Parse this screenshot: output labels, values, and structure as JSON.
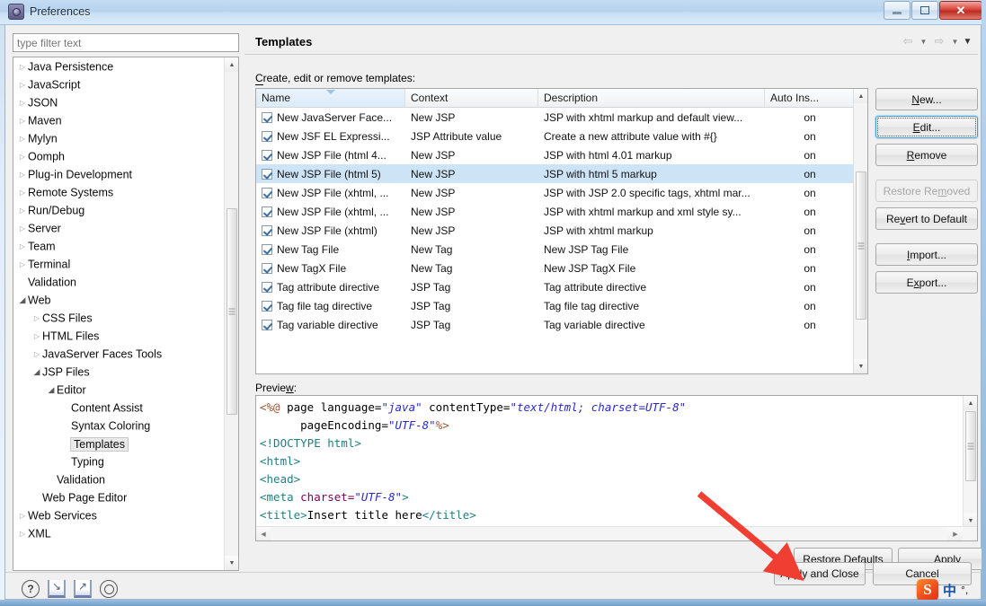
{
  "window": {
    "title": "Preferences",
    "icon": "preferences-icon",
    "minimize_label": "",
    "maximize_label": "",
    "close_label": "✕"
  },
  "sidebar": {
    "filter": {
      "placeholder": "type filter text",
      "value": ""
    },
    "items": [
      {
        "label": "Java Persistence",
        "indent": 0,
        "state": "closed"
      },
      {
        "label": "JavaScript",
        "indent": 0,
        "state": "closed"
      },
      {
        "label": "JSON",
        "indent": 0,
        "state": "closed"
      },
      {
        "label": "Maven",
        "indent": 0,
        "state": "closed"
      },
      {
        "label": "Mylyn",
        "indent": 0,
        "state": "closed"
      },
      {
        "label": "Oomph",
        "indent": 0,
        "state": "closed"
      },
      {
        "label": "Plug-in Development",
        "indent": 0,
        "state": "closed"
      },
      {
        "label": "Remote Systems",
        "indent": 0,
        "state": "closed"
      },
      {
        "label": "Run/Debug",
        "indent": 0,
        "state": "closed"
      },
      {
        "label": "Server",
        "indent": 0,
        "state": "closed"
      },
      {
        "label": "Team",
        "indent": 0,
        "state": "closed"
      },
      {
        "label": "Terminal",
        "indent": 0,
        "state": "closed"
      },
      {
        "label": "Validation",
        "indent": 0,
        "state": "leaf"
      },
      {
        "label": "Web",
        "indent": 0,
        "state": "open"
      },
      {
        "label": "CSS Files",
        "indent": 1,
        "state": "closed"
      },
      {
        "label": "HTML Files",
        "indent": 1,
        "state": "closed"
      },
      {
        "label": "JavaServer Faces Tools",
        "indent": 1,
        "state": "closed"
      },
      {
        "label": "JSP Files",
        "indent": 1,
        "state": "open"
      },
      {
        "label": "Editor",
        "indent": 2,
        "state": "open"
      },
      {
        "label": "Content Assist",
        "indent": 3,
        "state": "leaf"
      },
      {
        "label": "Syntax Coloring",
        "indent": 3,
        "state": "leaf"
      },
      {
        "label": "Templates",
        "indent": 3,
        "state": "leaf",
        "selected": true
      },
      {
        "label": "Typing",
        "indent": 3,
        "state": "leaf"
      },
      {
        "label": "Validation",
        "indent": 2,
        "state": "leaf"
      },
      {
        "label": "Web Page Editor",
        "indent": 1,
        "state": "leaf"
      },
      {
        "label": "Web Services",
        "indent": 0,
        "state": "closed"
      },
      {
        "label": "XML",
        "indent": 0,
        "state": "closed"
      }
    ]
  },
  "content": {
    "title": "Templates",
    "subtitle_prefix": "C",
    "subtitle": "reate, edit or remove templates:",
    "preview_label_prefix": "Previe",
    "preview_label_mid": "w",
    "preview_label_suffix": ":",
    "nav": {
      "back_icon": "back-arrow-icon",
      "back_caret": "▼",
      "forward_icon": "forward-arrow-icon",
      "forward_caret": "▼",
      "menu_caret": "▼"
    }
  },
  "table": {
    "columns": [
      "Name",
      "Context",
      "Description",
      "Auto Ins..."
    ],
    "sort_column": "Name",
    "rows": [
      {
        "checked": true,
        "name": "New JavaServer Face...",
        "context": "New JSP",
        "description": "JSP with xhtml markup and default view...",
        "auto": "on",
        "selected": false
      },
      {
        "checked": true,
        "name": "New JSF EL Expressi...",
        "context": "JSP Attribute value",
        "description": "Create a new attribute value with #{}",
        "auto": "on",
        "selected": false
      },
      {
        "checked": true,
        "name": "New JSP File (html 4...",
        "context": "New JSP",
        "description": "JSP with html 4.01 markup",
        "auto": "on",
        "selected": false
      },
      {
        "checked": true,
        "name": "New JSP File (html 5)",
        "context": "New JSP",
        "description": "JSP with html 5 markup",
        "auto": "on",
        "selected": true
      },
      {
        "checked": true,
        "name": "New JSP File (xhtml, ...",
        "context": "New JSP",
        "description": "JSP with JSP 2.0 specific tags, xhtml mar...",
        "auto": "on",
        "selected": false
      },
      {
        "checked": true,
        "name": "New JSP File (xhtml, ...",
        "context": "New JSP",
        "description": "JSP with xhtml markup and xml style sy...",
        "auto": "on",
        "selected": false
      },
      {
        "checked": true,
        "name": "New JSP File (xhtml)",
        "context": "New JSP",
        "description": "JSP with xhtml markup",
        "auto": "on",
        "selected": false
      },
      {
        "checked": true,
        "name": "New Tag File",
        "context": "New Tag",
        "description": "New JSP Tag File",
        "auto": "on",
        "selected": false
      },
      {
        "checked": true,
        "name": "New TagX File",
        "context": "New Tag",
        "description": "New JSP TagX File",
        "auto": "on",
        "selected": false
      },
      {
        "checked": true,
        "name": "Tag attribute directive",
        "context": "JSP Tag",
        "description": "Tag attribute directive",
        "auto": "on",
        "selected": false
      },
      {
        "checked": true,
        "name": "Tag file tag directive",
        "context": "JSP Tag",
        "description": "Tag file tag directive",
        "auto": "on",
        "selected": false
      },
      {
        "checked": true,
        "name": "Tag variable directive",
        "context": "JSP Tag",
        "description": "Tag variable directive",
        "auto": "on",
        "selected": false
      }
    ]
  },
  "side_buttons": [
    {
      "label": "New...",
      "mnemonic": "N",
      "before": "",
      "after": "ew...",
      "state": "normal"
    },
    {
      "label": "Edit...",
      "mnemonic": "E",
      "before": "",
      "after": "dit...",
      "state": "focused"
    },
    {
      "label": "Remove",
      "mnemonic": "R",
      "before": "",
      "after": "emove",
      "state": "normal"
    },
    {
      "label": "Restore Removed",
      "mnemonic": "m",
      "before": "Restore Re",
      "after": "oved",
      "state": "disabled"
    },
    {
      "label": "Revert to Default",
      "mnemonic": "v",
      "before": "Re",
      "after": "ert to Default",
      "state": "normal"
    },
    {
      "label": "Import...",
      "mnemonic": "I",
      "before": "",
      "after": "mport...",
      "state": "normal"
    },
    {
      "label": "Export...",
      "mnemonic": "x",
      "before": "E",
      "after": "port...",
      "state": "normal"
    }
  ],
  "preview_code": {
    "line1_a": "<%@",
    "line1_b": " page language=",
    "line1_c": "\"java\"",
    "line1_d": " contentType=",
    "line1_e": "\"text/html; charset=UTF-8\"",
    "line2_a": "      pageEncoding=",
    "line2_b": "\"UTF-8\"",
    "line2_c": "%>",
    "line3": "<!DOCTYPE html>",
    "line4": "<html>",
    "line5": "<head>",
    "line6_a": "<meta ",
    "line6_b": "charset=",
    "line6_c": "\"UTF-8\"",
    "line6_d": ">",
    "line7_a": "<title>",
    "line7_b": "Insert title here",
    "line7_c": "</title>"
  },
  "bottom_buttons": [
    {
      "label": "Restore Defaults",
      "before": "Restore ",
      "mnemonic": "D",
      "after": "efaults"
    },
    {
      "label": "Apply",
      "before": "",
      "mnemonic": "A",
      "after": "pply"
    },
    {
      "label": "Apply and Close",
      "before": "",
      "mnemonic": "",
      "after": "Apply and Close"
    },
    {
      "label": "Cancel",
      "before": "",
      "mnemonic": "",
      "after": "Cancel"
    }
  ],
  "corner_icons": [
    {
      "name": "help-icon",
      "glyph": "?"
    },
    {
      "name": "import-preferences-icon",
      "glyph": "↙"
    },
    {
      "name": "export-preferences-icon",
      "glyph": "↗"
    },
    {
      "name": "oomph-record-icon",
      "glyph": "◎"
    }
  ],
  "tray": {
    "ime_logo": "S",
    "ime_mode": "中",
    "ime_punct": "°,"
  },
  "colors": {
    "selection": "#cde4f7",
    "focus_border": "#3c9ad6",
    "annotation_arrow": "#f03e32",
    "title_bar": "#b6d3ee"
  }
}
